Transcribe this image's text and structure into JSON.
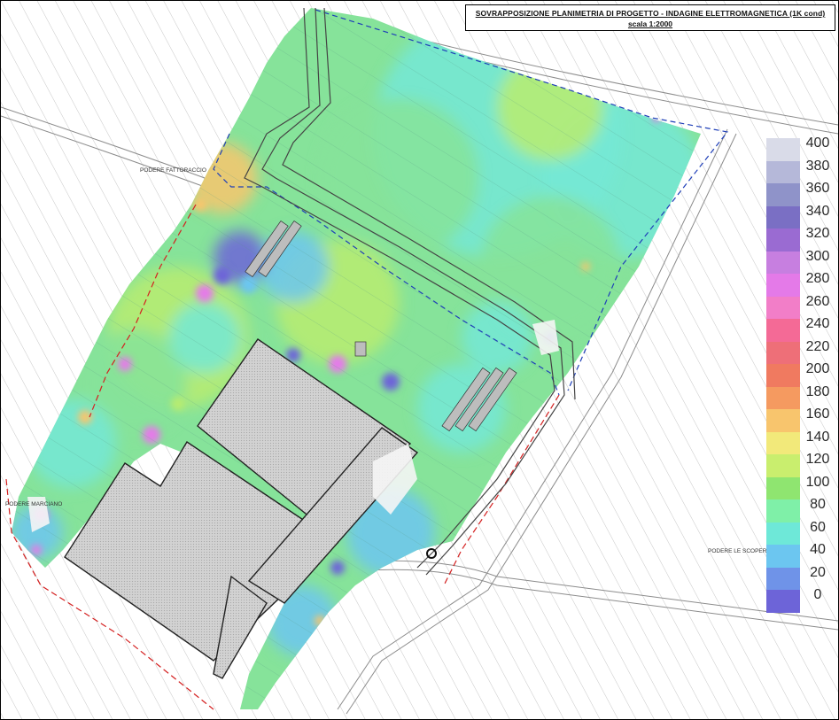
{
  "title": {
    "main": "SOVRAPPOSIZIONE PLANIMETRIA DI PROGETTO - INDAGINE ELETTROMAGNETICA (1K cond)",
    "scale": "scala 1:2000"
  },
  "place_labels": {
    "podere_fattoraccio": "PODERE FATTORACCIO",
    "podere_le_scoperte": "PODERE LE SCOPERTE",
    "podere_marciano": "PODERE MARCIANO"
  },
  "legend": {
    "labels": [
      "400",
      "380",
      "360",
      "340",
      "320",
      "300",
      "280",
      "260",
      "240",
      "220",
      "200",
      "180",
      "160",
      "140",
      "120",
      "100",
      "80",
      "60",
      "40",
      "20",
      "0"
    ],
    "colors": [
      "#d9dbe8",
      "#b5b8d9",
      "#8f93c9",
      "#7a6fc4",
      "#9a6bd2",
      "#c77fe0",
      "#e47ae8",
      "#f27ec8",
      "#f46a96",
      "#ee6f78",
      "#f07a60",
      "#f59a60",
      "#f8c56d",
      "#f2e97a",
      "#c9ee6e",
      "#8fe570",
      "#7ff0a8",
      "#6ee8d8",
      "#6cc6f0",
      "#6f93e8",
      "#6d64d8"
    ]
  },
  "heatmap_colors": {
    "low": "#6d64d8",
    "mid_low": "#6cc6f0",
    "base_cyan": "#74e8d6",
    "base_green": "#86e39a",
    "mid": "#b8ec70",
    "high": "#f8c56d",
    "peak": "#e47ae8"
  },
  "building_fill": "#cfcfcf",
  "boundary_blue": "#1f3fb8",
  "boundary_red": "#d42020"
}
